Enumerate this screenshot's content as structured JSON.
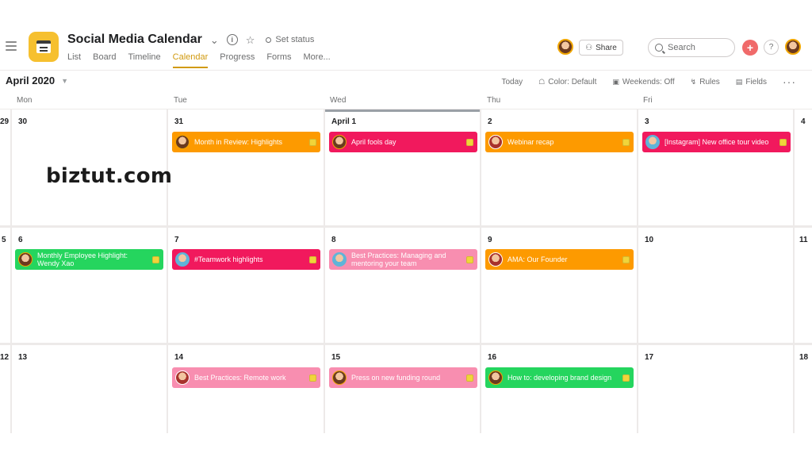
{
  "header": {
    "project_title": "Social Media Calendar",
    "set_status": "Set status",
    "tabs": [
      {
        "label": "List",
        "active": false
      },
      {
        "label": "Board",
        "active": false
      },
      {
        "label": "Timeline",
        "active": false
      },
      {
        "label": "Calendar",
        "active": true
      },
      {
        "label": "Progress",
        "active": false
      },
      {
        "label": "Forms",
        "active": false
      },
      {
        "label": "More...",
        "active": false
      }
    ],
    "share_label": "Share",
    "search_placeholder": "Search",
    "plus_symbol": "+",
    "help_symbol": "?",
    "accent_color": "#d19a0f",
    "app_icon_color": "#f6c02f"
  },
  "toolbar": {
    "month": "April 2020",
    "today": "Today",
    "color": "Color: Default",
    "weekends": "Weekends: Off",
    "rules": "Rules",
    "fields": "Fields",
    "more": "···"
  },
  "calendar": {
    "weekdays": [
      "Mon",
      "Tue",
      "Wed",
      "Thu",
      "Fri"
    ],
    "weeks": [
      {
        "days": [
          "29",
          "30",
          "31",
          "April 1",
          "2",
          "3",
          "4"
        ]
      },
      {
        "days": [
          "5",
          "6",
          "7",
          "8",
          "9",
          "10",
          "11"
        ]
      },
      {
        "days": [
          "12",
          "13",
          "14",
          "15",
          "16",
          "17",
          "18"
        ]
      }
    ],
    "events": {
      "w1_tue": {
        "text": "Month in Review: Highlights",
        "color": "#fd9a00"
      },
      "w1_wed": {
        "text": "April fools day",
        "color": "#f1195d"
      },
      "w1_thu": {
        "text": "Webinar recap",
        "color": "#fd9a00"
      },
      "w1_fri": {
        "text": "[Instagram] New office tour video",
        "color": "#f1195d"
      },
      "w2_mon": {
        "text": "Monthly Employee Highlight: Wendy Xao",
        "color": "#25d55e"
      },
      "w2_tue": {
        "text": "#Teamwork highlights",
        "color": "#f1195d"
      },
      "w2_wed": {
        "text": "Best Practices: Managing and mentoring your team",
        "color": "#f88eb0"
      },
      "w2_thu": {
        "text": "AMA: Our Founder",
        "color": "#fd9a00"
      },
      "w3_tue": {
        "text": "Best Practices: Remote work",
        "color": "#f88eb0"
      },
      "w3_wed": {
        "text": "Press on new funding round",
        "color": "#f88eb0"
      },
      "w3_thu": {
        "text": "How to: developing brand design",
        "color": "#25d55e"
      }
    }
  },
  "watermark": "biztut.com"
}
